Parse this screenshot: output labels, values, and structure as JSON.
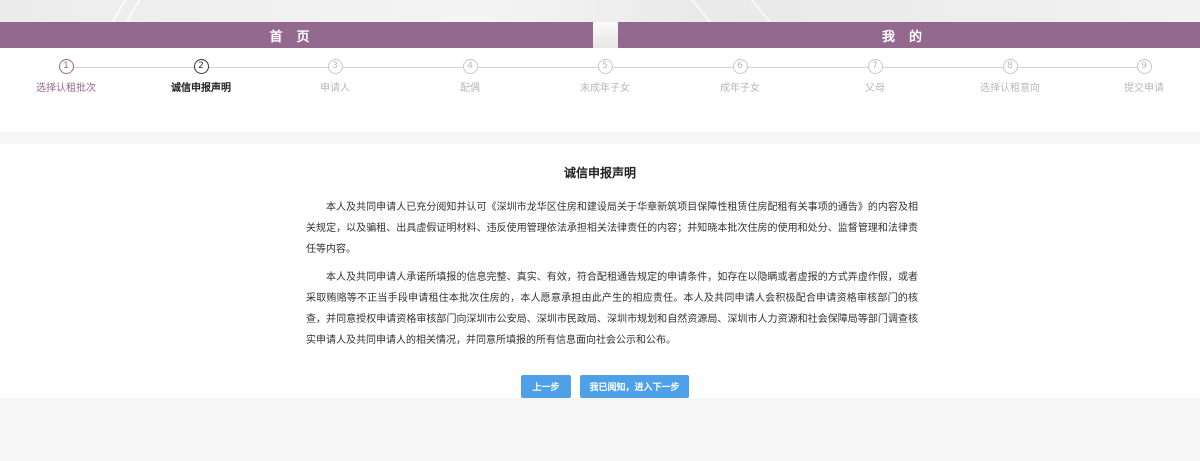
{
  "nav": {
    "home_label": "首页",
    "mine_label": "我的"
  },
  "steps": [
    {
      "num": "1",
      "label": "选择认租批次",
      "state": "done"
    },
    {
      "num": "2",
      "label": "诚信申报声明",
      "state": "active"
    },
    {
      "num": "3",
      "label": "申请人",
      "state": "pending"
    },
    {
      "num": "4",
      "label": "配偶",
      "state": "pending"
    },
    {
      "num": "5",
      "label": "未成年子女",
      "state": "pending"
    },
    {
      "num": "6",
      "label": "成年子女",
      "state": "pending"
    },
    {
      "num": "7",
      "label": "父母",
      "state": "pending"
    },
    {
      "num": "8",
      "label": "选择认租意向",
      "state": "pending"
    },
    {
      "num": "9",
      "label": "提交申请",
      "state": "pending"
    }
  ],
  "declaration": {
    "title": "诚信申报声明",
    "paragraph1": "本人及共同申请人已充分阅知并认可《深圳市龙华区住房和建设局关于华章新筑项目保障性租赁住房配租有关事项的通告》的内容及相关规定，以及骗租、出具虚假证明材料、违反使用管理依法承担相关法律责任的内容；并知晓本批次住房的使用和处分、监督管理和法律责任等内容。",
    "paragraph2": "本人及共同申请人承诺所填报的信息完整、真实、有效，符合配租通告规定的申请条件，如存在以隐瞒或者虚报的方式弄虚作假，或者采取贿赂等不正当手段申请租住本批次住房的，本人愿意承担由此产生的相应责任。本人及共同申请人会积极配合申请资格审核部门的核查，并同意授权申请资格审核部门向深圳市公安局、深圳市民政局、深圳市规划和自然资源局、深圳市人力资源和社会保障局等部门调查核实申请人及共同申请人的相关情况，并同意所填报的所有信息面向社会公示和公布。"
  },
  "buttons": {
    "prev_label": "上一步",
    "next_label": "我已阅知，进入下一步"
  },
  "colors": {
    "nav_bg": "#93698f",
    "button_bg": "#4ea1e8",
    "step_done": "#93698f",
    "step_active": "#333333",
    "step_pending": "#b8b8b8"
  }
}
